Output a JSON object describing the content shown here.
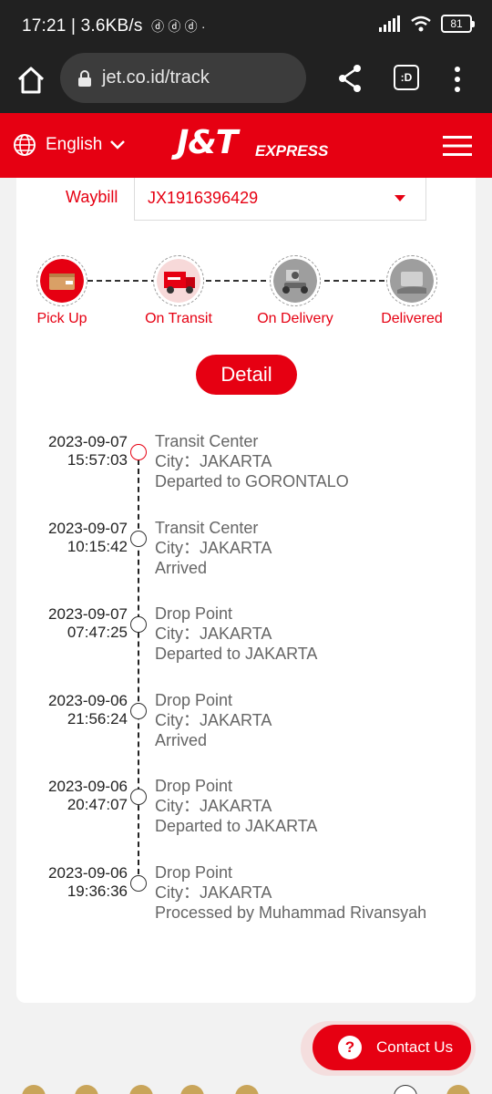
{
  "status_bar": {
    "time": "17:21",
    "speed": "3.6KB/s",
    "battery": "81"
  },
  "browser": {
    "url": "jet.co.id/track",
    "tabs_label": ":D"
  },
  "header": {
    "language": "English",
    "logo_text": "J&T",
    "logo_sub": "EXPRESS",
    "brand_color": "#e60012"
  },
  "waybill": {
    "label": "Waybill",
    "value": "JX1916396429"
  },
  "steps": [
    {
      "label": "Pick Up",
      "icon": "pickup-icon"
    },
    {
      "label": "On Transit",
      "icon": "truck-icon"
    },
    {
      "label": "On Delivery",
      "icon": "courier-icon"
    },
    {
      "label": "Delivered",
      "icon": "package-icon"
    }
  ],
  "detail_button": "Detail",
  "timeline": [
    {
      "date": "2023-09-07",
      "time": "15:57:03",
      "title": "Transit Center",
      "city": "City：JAKARTA",
      "status": "Departed to GORONTALO"
    },
    {
      "date": "2023-09-07",
      "time": "10:15:42",
      "title": "Transit Center",
      "city": "City：JAKARTA",
      "status": "Arrived"
    },
    {
      "date": "2023-09-07",
      "time": "07:47:25",
      "title": "Drop Point",
      "city": "City：JAKARTA",
      "status": "Departed to JAKARTA"
    },
    {
      "date": "2023-09-06",
      "time": "21:56:24",
      "title": "Drop Point",
      "city": "City：JAKARTA",
      "status": "Arrived"
    },
    {
      "date": "2023-09-06",
      "time": "20:47:07",
      "title": "Drop Point",
      "city": "City：JAKARTA",
      "status": "Departed to JAKARTA"
    },
    {
      "date": "2023-09-06",
      "time": "19:36:36",
      "title": "Drop Point",
      "city": "City：JAKARTA",
      "status": "Processed by Muhammad Rivansyah"
    }
  ],
  "contact": {
    "label": "Contact Us",
    "icon_glyph": "?"
  }
}
